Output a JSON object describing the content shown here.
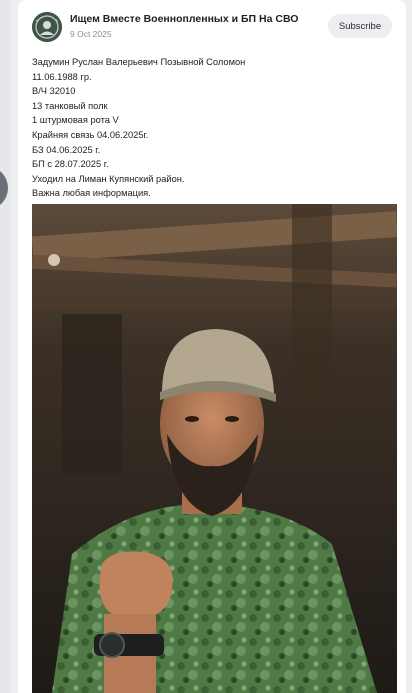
{
  "channel": {
    "title": "Ищем Вместе Военнопленных и БП На СВО",
    "date": "9 Oct 2025",
    "avatar_icon": "channel-avatar-icon"
  },
  "actions": {
    "subscribe_label": "Subscribe"
  },
  "post": {
    "lines": [
      "Задумин Руслан Валерьевич Позывной Соломон",
      "11.06.1988 гр.",
      "В/Ч  32010",
      "13 танковый полк",
      "1 штурмовая рота V",
      "Крайняя связь  04.06.2025г.",
      "БЗ  04.06.2025 г.",
      "БП с 28.07.2025 г.",
      "Уходил на Лиман Купянский район.",
      "Важна любая информация."
    ]
  },
  "photo": {
    "subject": "man in camouflage t-shirt and cap raising a fist"
  },
  "colors": {
    "background": "#edeef0",
    "card": "#ffffff",
    "subscribe_bg": "#eceef1",
    "date_text": "#8b8f96"
  }
}
